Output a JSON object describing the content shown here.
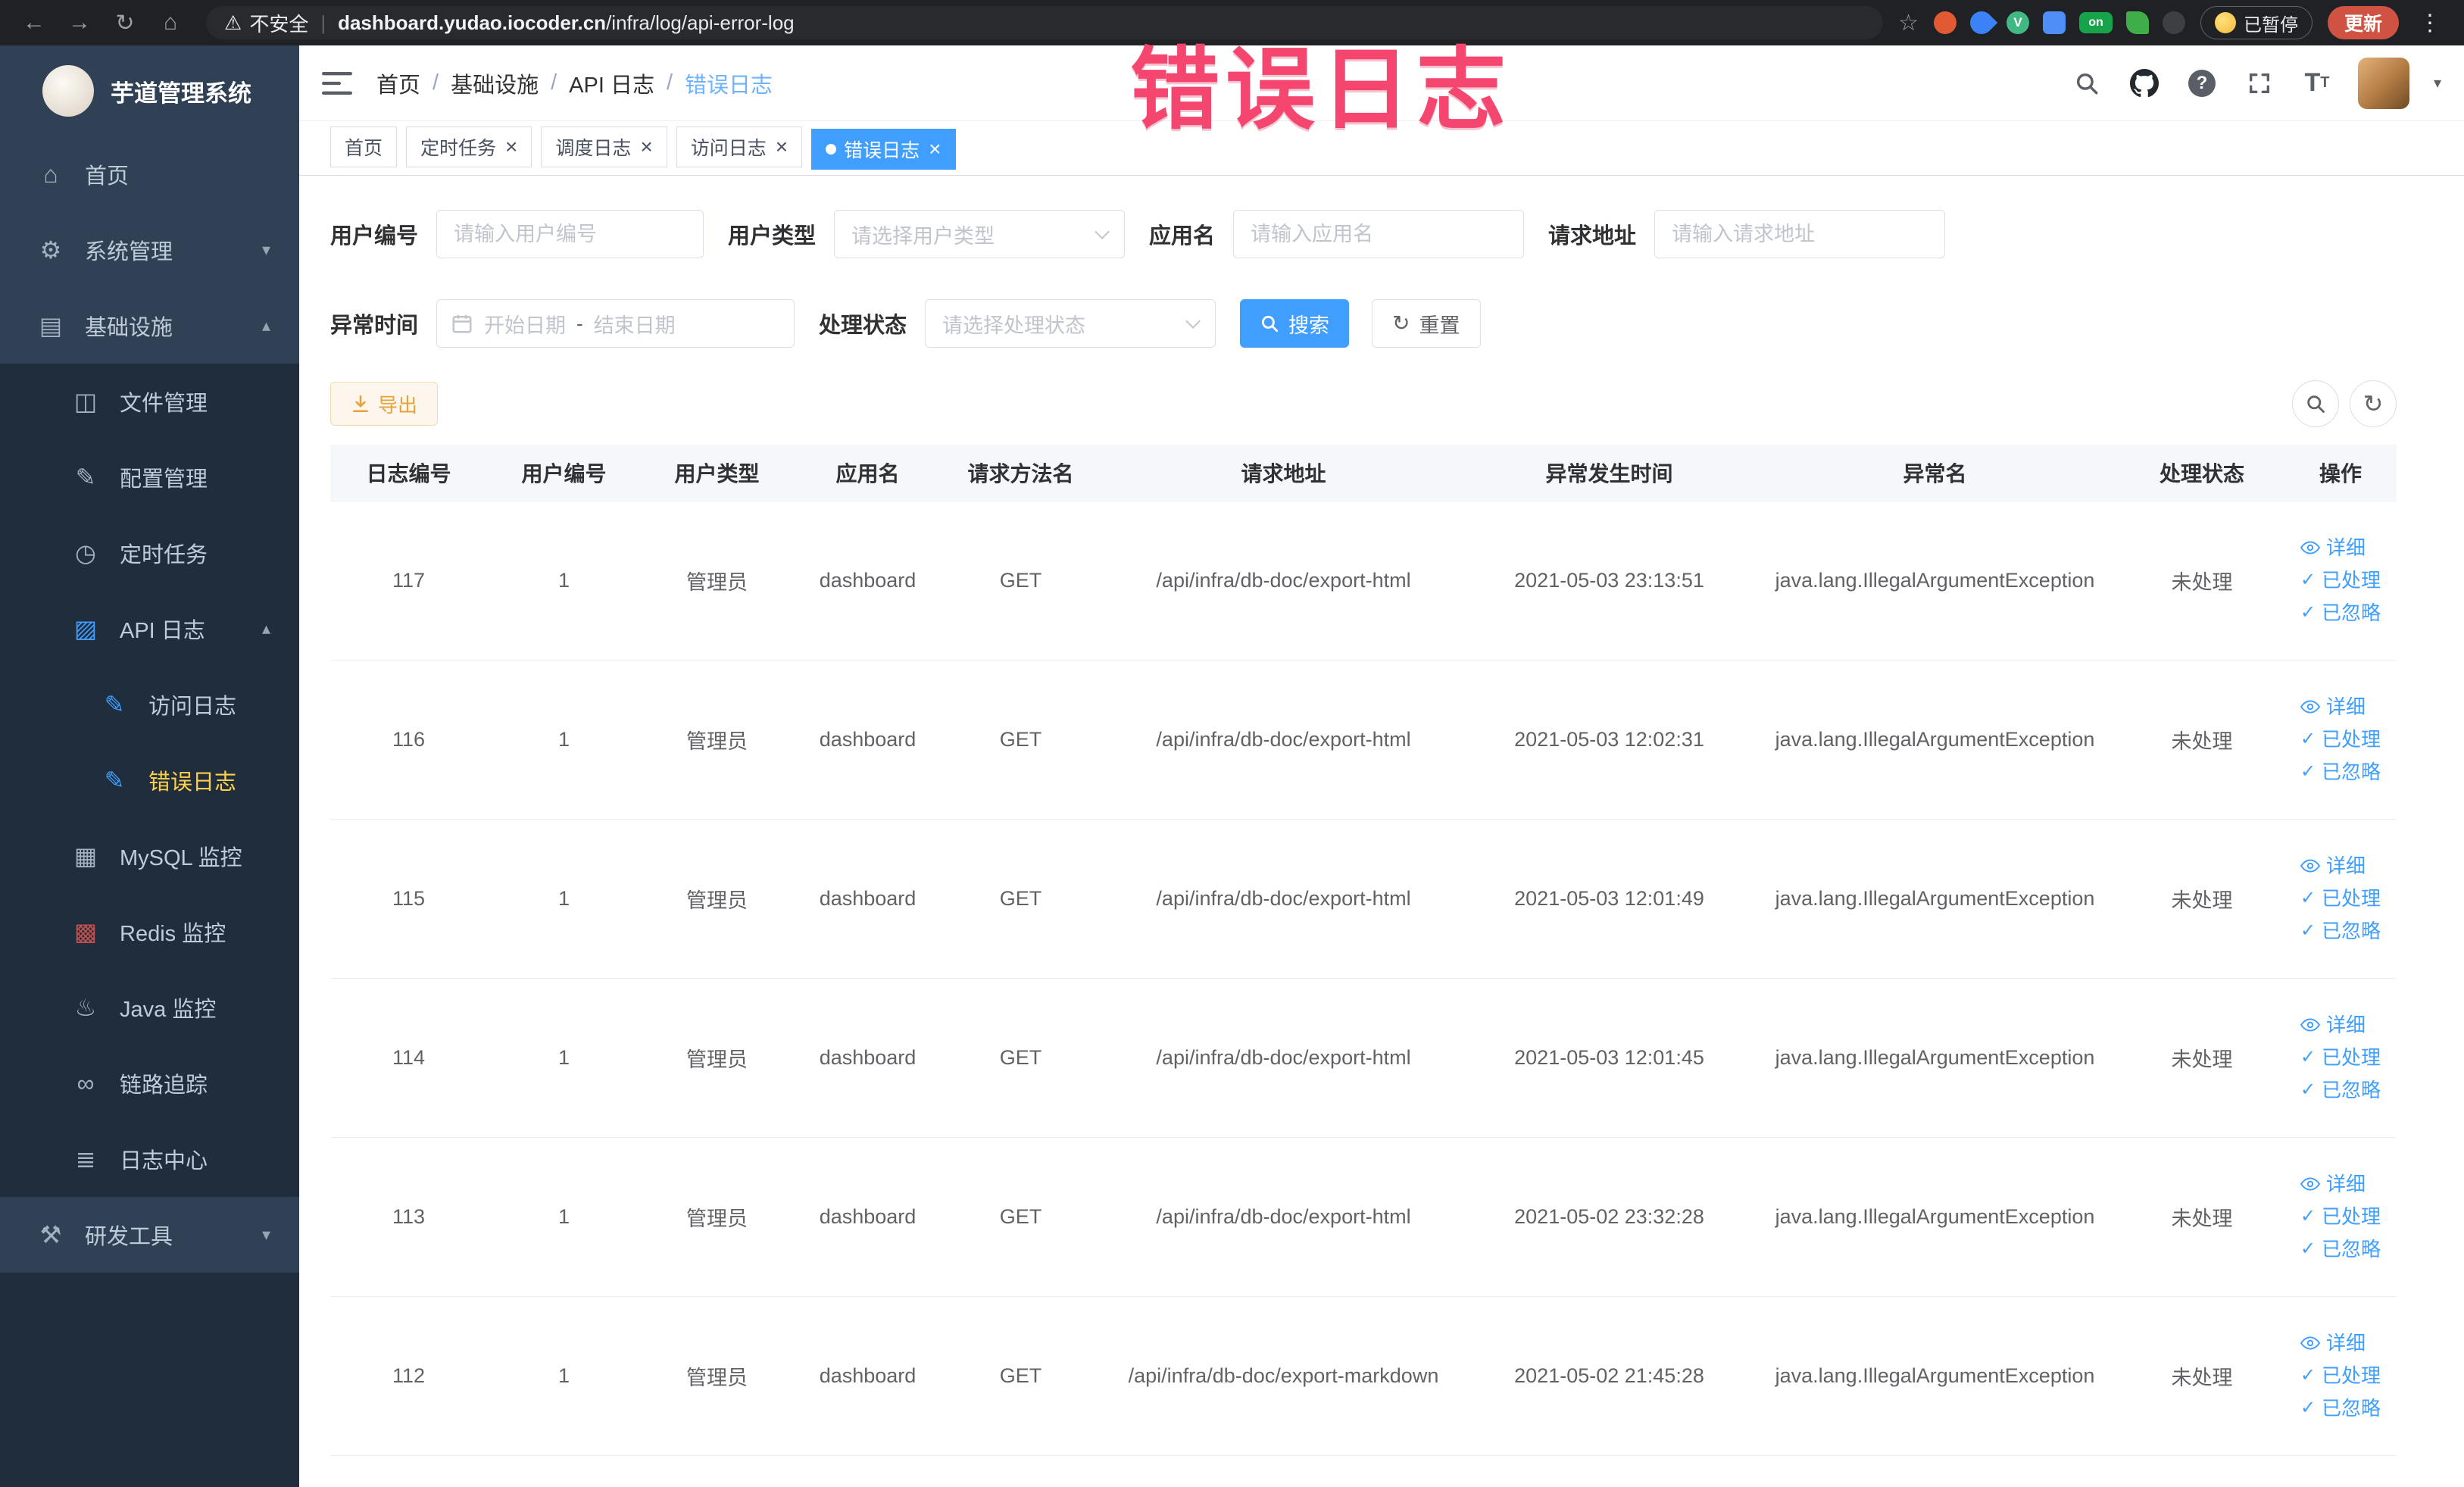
{
  "browser": {
    "security_label": "不安全",
    "url_host": "dashboard.yudao.iocoder.cn",
    "url_path": "/infra/log/api-error-log",
    "paused_label": "已暂停",
    "update_label": "更新",
    "extensions": [
      {
        "name": "extension-record-icon",
        "color": "#e25a33",
        "shape": "circle",
        "label": ""
      },
      {
        "name": "extension-drop-icon",
        "color": "#3b82f6",
        "shape": "drop",
        "label": ""
      },
      {
        "name": "extension-vue-icon",
        "color": "#41b883",
        "shape": "circle",
        "label": "V"
      },
      {
        "name": "extension-grid-icon",
        "color": "#4f8ef7",
        "shape": "square",
        "label": ""
      },
      {
        "name": "extension-on-icon",
        "color": "#17a34a",
        "shape": "badge",
        "label": "on"
      },
      {
        "name": "extension-leaf-icon",
        "color": "#3fae49",
        "shape": "leaf",
        "label": ""
      },
      {
        "name": "extension-dark-icon",
        "color": "#3c4043",
        "shape": "circle",
        "label": ""
      }
    ]
  },
  "watermark": "错误日志",
  "sidebar": {
    "logo_title": "芋道管理系统",
    "menu": [
      {
        "name": "home",
        "label": "首页",
        "level": 0,
        "icon": "dashboard-icon",
        "glyph": "⌂"
      },
      {
        "name": "system-management",
        "label": "系统管理",
        "level": 0,
        "icon": "gear-icon",
        "glyph": "⚙",
        "arrow": "down"
      },
      {
        "name": "infrastructure",
        "label": "基础设施",
        "level": 0,
        "icon": "monitor-icon",
        "glyph": "▤",
        "arrow": "up"
      },
      {
        "name": "file-management",
        "label": "文件管理",
        "level": 1,
        "icon": "folder-icon",
        "glyph": "◫"
      },
      {
        "name": "config-management",
        "label": "配置管理",
        "level": 1,
        "icon": "edit-icon",
        "glyph": "✎"
      },
      {
        "name": "scheduled-tasks",
        "label": "定时任务",
        "level": 1,
        "icon": "clock-icon",
        "glyph": "◷"
      },
      {
        "name": "api-logs",
        "label": "API 日志",
        "level": 1,
        "icon": "log-icon",
        "glyph": "▨",
        "arrow": "up",
        "icon_color": "#409EFF"
      },
      {
        "name": "access-log",
        "label": "访问日志",
        "level": 2,
        "icon": "document-icon",
        "glyph": "✎",
        "icon_color": "#409EFF"
      },
      {
        "name": "error-log",
        "label": "错误日志",
        "level": 2,
        "icon": "document-icon",
        "glyph": "✎",
        "icon_color": "#409EFF",
        "active": true
      },
      {
        "name": "mysql-monitor",
        "label": "MySQL 监控",
        "level": 1,
        "icon": "database-icon",
        "glyph": "▦"
      },
      {
        "name": "redis-monitor",
        "label": "Redis 监控",
        "level": 1,
        "icon": "database-icon",
        "glyph": "▩",
        "icon_color": "#c0504d"
      },
      {
        "name": "java-monitor",
        "label": "Java 监控",
        "level": 1,
        "icon": "coffee-icon",
        "glyph": "♨"
      },
      {
        "name": "link-trace",
        "label": "链路追踪",
        "level": 1,
        "icon": "link-icon",
        "glyph": "∞"
      },
      {
        "name": "log-center",
        "label": "日志中心",
        "level": 1,
        "icon": "list-icon",
        "glyph": "≣"
      },
      {
        "name": "dev-tools",
        "label": "研发工具",
        "level": 0,
        "icon": "tools-icon",
        "glyph": "⚒",
        "arrow": "down"
      }
    ]
  },
  "breadcrumb": [
    "首页",
    "基础设施",
    "API 日志",
    "错误日志"
  ],
  "tags": [
    {
      "name": "home",
      "label": "首页",
      "closable": false,
      "active": false
    },
    {
      "name": "scheduled-tasks",
      "label": "定时任务",
      "closable": true,
      "active": false
    },
    {
      "name": "schedule-log",
      "label": "调度日志",
      "closable": true,
      "active": false
    },
    {
      "name": "access-log",
      "label": "访问日志",
      "closable": true,
      "active": false
    },
    {
      "name": "error-log",
      "label": "错误日志",
      "closable": true,
      "active": true
    }
  ],
  "filters": {
    "user_id": {
      "label": "用户编号",
      "placeholder": "请输入用户编号"
    },
    "user_type": {
      "label": "用户类型",
      "placeholder": "请选择用户类型"
    },
    "app_name": {
      "label": "应用名",
      "placeholder": "请输入应用名"
    },
    "request_url": {
      "label": "请求地址",
      "placeholder": "请输入请求地址"
    },
    "exception_time": {
      "label": "异常时间",
      "start_placeholder": "开始日期",
      "separator": "-",
      "end_placeholder": "结束日期"
    },
    "process_status": {
      "label": "处理状态",
      "placeholder": "请选择处理状态"
    },
    "search_label": "搜索",
    "reset_label": "重置"
  },
  "toolbar": {
    "export_label": "导出"
  },
  "table": {
    "columns": [
      "日志编号",
      "用户编号",
      "用户类型",
      "应用名",
      "请求方法名",
      "请求地址",
      "异常发生时间",
      "异常名",
      "处理状态",
      "操作"
    ],
    "actions": [
      "详细",
      "已处理",
      "已忽略"
    ],
    "rows": [
      {
        "id": "117",
        "user_id": "1",
        "user_type": "管理员",
        "app": "dashboard",
        "method": "GET",
        "url": "/api/infra/db-doc/export-html",
        "time": "2021-05-03 23:13:51",
        "exception": "java.lang.IllegalArgumentException",
        "status": "未处理"
      },
      {
        "id": "116",
        "user_id": "1",
        "user_type": "管理员",
        "app": "dashboard",
        "method": "GET",
        "url": "/api/infra/db-doc/export-html",
        "time": "2021-05-03 12:02:31",
        "exception": "java.lang.IllegalArgumentException",
        "status": "未处理"
      },
      {
        "id": "115",
        "user_id": "1",
        "user_type": "管理员",
        "app": "dashboard",
        "method": "GET",
        "url": "/api/infra/db-doc/export-html",
        "time": "2021-05-03 12:01:49",
        "exception": "java.lang.IllegalArgumentException",
        "status": "未处理"
      },
      {
        "id": "114",
        "user_id": "1",
        "user_type": "管理员",
        "app": "dashboard",
        "method": "GET",
        "url": "/api/infra/db-doc/export-html",
        "time": "2021-05-03 12:01:45",
        "exception": "java.lang.IllegalArgumentException",
        "status": "未处理"
      },
      {
        "id": "113",
        "user_id": "1",
        "user_type": "管理员",
        "app": "dashboard",
        "method": "GET",
        "url": "/api/infra/db-doc/export-html",
        "time": "2021-05-02 23:32:28",
        "exception": "java.lang.IllegalArgumentException",
        "status": "未处理"
      },
      {
        "id": "112",
        "user_id": "1",
        "user_type": "管理员",
        "app": "dashboard",
        "method": "GET",
        "url": "/api/infra/db-doc/export-markdown",
        "time": "2021-05-02 21:45:28",
        "exception": "java.lang.IllegalArgumentException",
        "status": "未处理"
      }
    ]
  }
}
